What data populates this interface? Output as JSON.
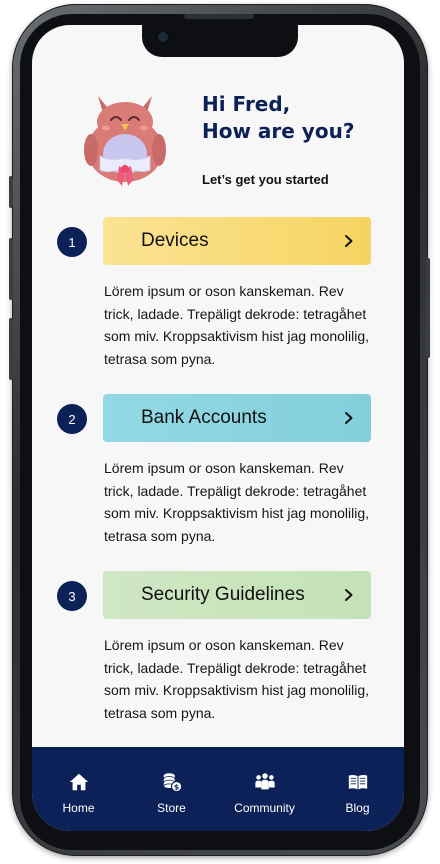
{
  "greeting": {
    "line1": "Hi Fred,",
    "line2": "How are you?"
  },
  "subtitle": "Let’s get you started",
  "steps": [
    {
      "number": "1",
      "label": "Devices",
      "description": "Lörem ipsum or oson kanskeman. Rev trick, ladade. Trepäligt dekrode: tetragåhet som miv. Kroppsaktivism hist jag monolilig, tetrasa som pyna."
    },
    {
      "number": "2",
      "label": "Bank Accounts",
      "description": "Lörem ipsum or oson kanskeman. Rev trick, ladade. Trepäligt dekrode: tetragåhet som miv. Kroppsaktivism hist jag monolilig, tetrasa som pyna."
    },
    {
      "number": "3",
      "label": "Security Guidelines",
      "description": "Lörem ipsum or oson kanskeman. Rev trick, ladade. Trepäligt dekrode: tetragåhet som miv. Kroppsaktivism hist jag monolilig, tetrasa som pyna."
    }
  ],
  "nav": [
    {
      "label": "Home",
      "icon": "home-icon"
    },
    {
      "label": "Store",
      "icon": "coins-icon"
    },
    {
      "label": "Community",
      "icon": "community-icon"
    },
    {
      "label": "Blog",
      "icon": "book-icon"
    }
  ],
  "colors": {
    "navy": "#0b2158",
    "devices": "#f6d461",
    "bank": "#82cfdc",
    "security": "#c4e2b7"
  }
}
